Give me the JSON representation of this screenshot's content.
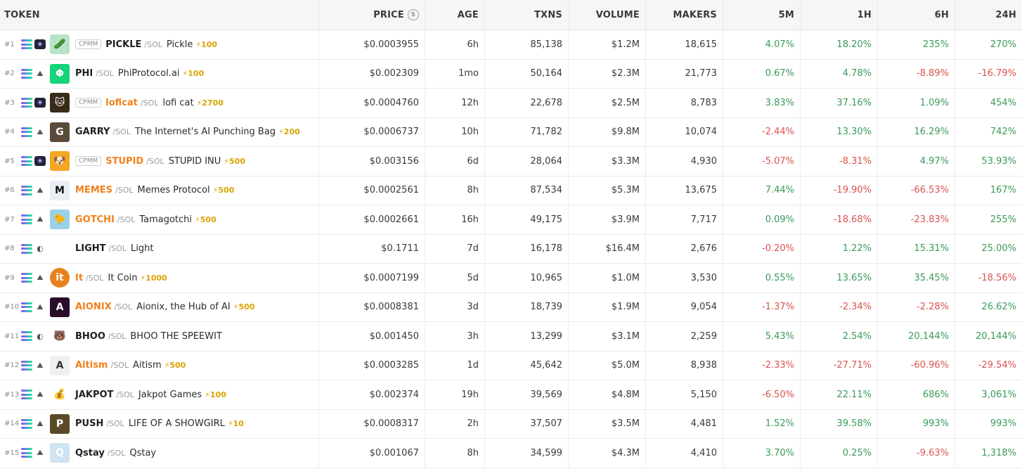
{
  "headers": {
    "token": "TOKEN",
    "price": "PRICE",
    "age": "AGE",
    "txns": "TXNS",
    "volume": "VOLUME",
    "makers": "MAKERS",
    "m5": "5M",
    "h1": "1H",
    "h6": "6H",
    "h24": "24H"
  },
  "rows": [
    {
      "rank": "#1",
      "cpmm": "CPMM",
      "symbol": "PICKLE",
      "quote": "/SOL",
      "name": "Pickle",
      "boost": "⚡100",
      "price": "$0.0003955",
      "age": "6h",
      "txns": "85,138",
      "volume": "$1.2M",
      "makers": "18,615",
      "m5": "4.07%",
      "h1": "18.20%",
      "h6": "235%",
      "h24": "270%"
    },
    {
      "rank": "#2",
      "cpmm": "",
      "symbol": "PHI",
      "quote": "/SOL",
      "name": "PhiProtocol.ai",
      "boost": "⚡100",
      "price": "$0.002309",
      "age": "1mo",
      "txns": "50,164",
      "volume": "$2.3M",
      "makers": "21,773",
      "m5": "0.67%",
      "h1": "4.78%",
      "h6": "-8.89%",
      "h24": "-16.79%"
    },
    {
      "rank": "#3",
      "cpmm": "CPMM",
      "symbol": "loficat",
      "quote": "/SOL",
      "name": "lofi cat",
      "boost": "⚡2700",
      "price": "$0.0004760",
      "age": "12h",
      "txns": "22,678",
      "volume": "$2.5M",
      "makers": "8,783",
      "m5": "3.83%",
      "h1": "37.16%",
      "h6": "1.09%",
      "h24": "454%"
    },
    {
      "rank": "#4",
      "cpmm": "",
      "symbol": "GARRY",
      "quote": "/SOL",
      "name": "The Internet's AI Punching Bag",
      "boost": "⚡200",
      "price": "$0.0006737",
      "age": "10h",
      "txns": "71,782",
      "volume": "$9.8M",
      "makers": "10,074",
      "m5": "-2.44%",
      "h1": "13.30%",
      "h6": "16.29%",
      "h24": "742%"
    },
    {
      "rank": "#5",
      "cpmm": "CPMM",
      "symbol": "STUPID",
      "quote": "/SOL",
      "name": "STUPID INU",
      "boost": "⚡500",
      "price": "$0.003156",
      "age": "6d",
      "txns": "28,064",
      "volume": "$3.3M",
      "makers": "4,930",
      "m5": "-5.07%",
      "h1": "-8.31%",
      "h6": "4.97%",
      "h24": "53.93%"
    },
    {
      "rank": "#6",
      "cpmm": "",
      "symbol": "MEMES",
      "quote": "/SOL",
      "name": "Memes Protocol",
      "boost": "⚡500",
      "price": "$0.0002561",
      "age": "8h",
      "txns": "87,534",
      "volume": "$5.3M",
      "makers": "13,675",
      "m5": "7.44%",
      "h1": "-19.90%",
      "h6": "-66.53%",
      "h24": "167%"
    },
    {
      "rank": "#7",
      "cpmm": "",
      "symbol": "GOTCHI",
      "quote": "/SOL",
      "name": "Tamagotchi",
      "boost": "⚡500",
      "price": "$0.0002661",
      "age": "16h",
      "txns": "49,175",
      "volume": "$3.9M",
      "makers": "7,717",
      "m5": "0.09%",
      "h1": "-18.68%",
      "h6": "-23.83%",
      "h24": "255%"
    },
    {
      "rank": "#8",
      "cpmm": "",
      "symbol": "LIGHT",
      "quote": "/SOL",
      "name": "Light",
      "boost": "",
      "price": "$0.1711",
      "age": "7d",
      "txns": "16,178",
      "volume": "$16.4M",
      "makers": "2,676",
      "m5": "-0.20%",
      "h1": "1.22%",
      "h6": "15.31%",
      "h24": "25.00%"
    },
    {
      "rank": "#9",
      "cpmm": "",
      "symbol": "It",
      "quote": "/SOL",
      "name": "It Coin",
      "boost": "⚡1000",
      "price": "$0.0007199",
      "age": "5d",
      "txns": "10,965",
      "volume": "$1.0M",
      "makers": "3,530",
      "m5": "0.55%",
      "h1": "13.65%",
      "h6": "35.45%",
      "h24": "-18.56%"
    },
    {
      "rank": "#10",
      "cpmm": "",
      "symbol": "AIONIX",
      "quote": "/SOL",
      "name": "Aionix, the Hub of AI",
      "boost": "⚡500",
      "price": "$0.0008381",
      "age": "3d",
      "txns": "18,739",
      "volume": "$1.9M",
      "makers": "9,054",
      "m5": "-1.37%",
      "h1": "-2.34%",
      "h6": "-2.28%",
      "h24": "26.62%"
    },
    {
      "rank": "#11",
      "cpmm": "",
      "symbol": "BHOO",
      "quote": "/SOL",
      "name": "BHOO THE SPEEWIT",
      "boost": "",
      "price": "$0.001450",
      "age": "3h",
      "txns": "13,299",
      "volume": "$3.1M",
      "makers": "2,259",
      "m5": "5.43%",
      "h1": "2.54%",
      "h6": "20,144%",
      "h24": "20,144%"
    },
    {
      "rank": "#12",
      "cpmm": "",
      "symbol": "Aitism",
      "quote": "/SOL",
      "name": "Aitism",
      "boost": "⚡500",
      "price": "$0.0003285",
      "age": "1d",
      "txns": "45,642",
      "volume": "$5.0M",
      "makers": "8,938",
      "m5": "-2.33%",
      "h1": "-27.71%",
      "h6": "-60.96%",
      "h24": "-29.54%"
    },
    {
      "rank": "#13",
      "cpmm": "",
      "symbol": "JAKPOT",
      "quote": "/SOL",
      "name": "Jakpot Games",
      "boost": "⚡100",
      "price": "$0.002374",
      "age": "19h",
      "txns": "39,569",
      "volume": "$4.8M",
      "makers": "5,150",
      "m5": "-6.50%",
      "h1": "22.11%",
      "h6": "686%",
      "h24": "3,061%"
    },
    {
      "rank": "#14",
      "cpmm": "",
      "symbol": "PUSH",
      "quote": "/SOL",
      "name": "LIFE OF A SHOWGIRL",
      "boost": "⚡10",
      "price": "$0.0008317",
      "age": "2h",
      "txns": "37,507",
      "volume": "$3.5M",
      "makers": "4,481",
      "m5": "1.52%",
      "h1": "39.58%",
      "h6": "993%",
      "h24": "993%"
    },
    {
      "rank": "#15",
      "cpmm": "",
      "symbol": "Qstay",
      "quote": "/SOL",
      "name": "Qstay",
      "boost": "",
      "price": "$0.001067",
      "age": "8h",
      "txns": "34,599",
      "volume": "$4.3M",
      "makers": "4,410",
      "m5": "3.70%",
      "h1": "0.25%",
      "h6": "-9.63%",
      "h24": "1,318%"
    }
  ]
}
